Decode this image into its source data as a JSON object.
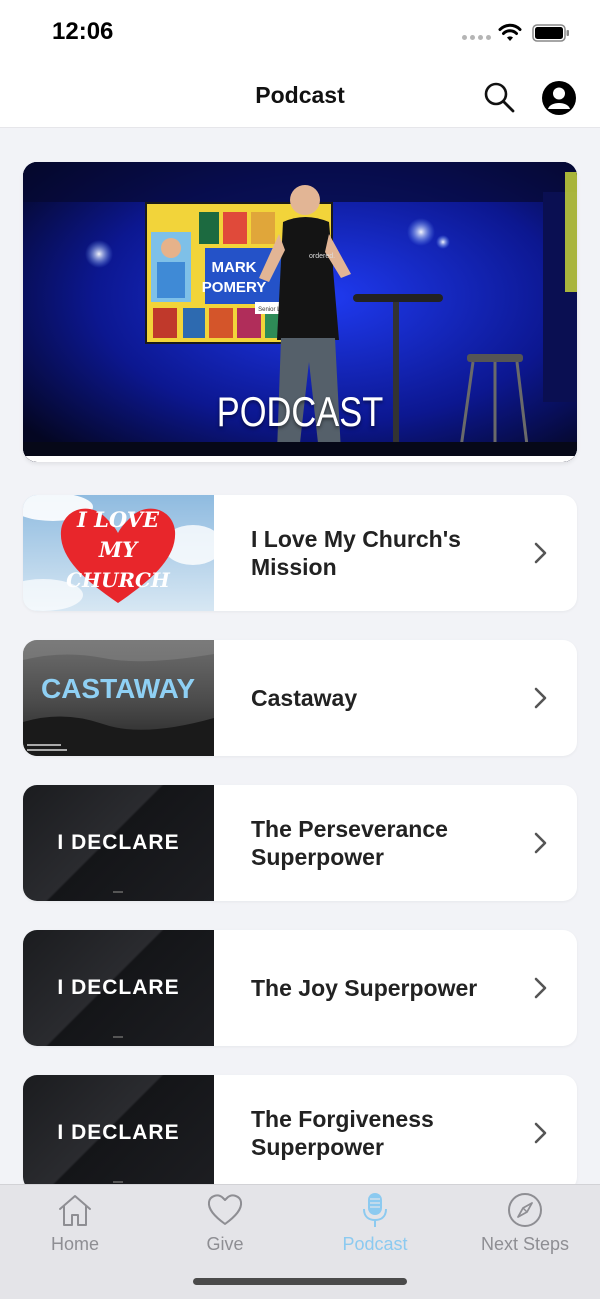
{
  "status_bar": {
    "time": "12:06"
  },
  "header": {
    "title": "Podcast",
    "search_icon": "search-icon",
    "profile_icon": "profile-icon"
  },
  "hero": {
    "label": "PODCAST",
    "slide_name_line1": "MARK",
    "slide_name_line2": "POMERY",
    "slide_role": "Senior Leader"
  },
  "podcast_items": [
    {
      "title": "I Love My Church's Mission",
      "thumb_text": [
        "I LOVE",
        "MY",
        "CHURCH"
      ]
    },
    {
      "title": "Castaway",
      "thumb_text": "CASTAWAY"
    },
    {
      "title": "The Perseverance Superpower",
      "thumb_text": "I DECLARE"
    },
    {
      "title": "The Joy Superpower",
      "thumb_text": "I DECLARE"
    },
    {
      "title": "The Forgiveness Superpower",
      "thumb_text": "I DECLARE"
    }
  ],
  "tab_bar": {
    "tabs": [
      {
        "label": "Home",
        "icon": "home-icon",
        "active": false
      },
      {
        "label": "Give",
        "icon": "heart-icon",
        "active": false
      },
      {
        "label": "Podcast",
        "icon": "microphone-icon",
        "active": true
      },
      {
        "label": "Next Steps",
        "icon": "compass-icon",
        "active": false
      }
    ]
  },
  "colors": {
    "accent": "#8ccaf0",
    "background": "#f2f3f7",
    "heart": "#e8262b",
    "hero_blue": "#1a2ad0"
  }
}
